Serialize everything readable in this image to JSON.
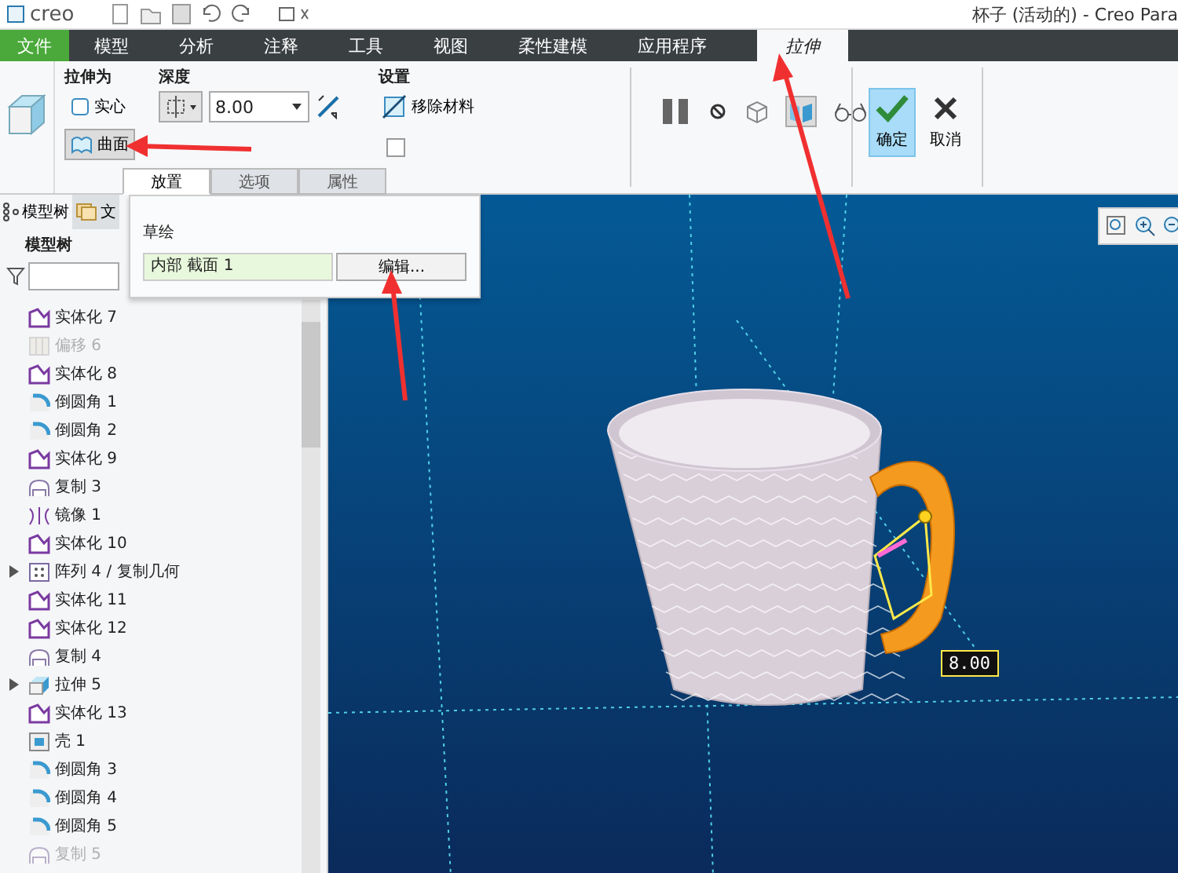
{
  "title_bar": {
    "logo": "creo",
    "title": "杯子 (活动的) - Creo Para"
  },
  "tabs": [
    {
      "label": "文件",
      "kind": "file",
      "selected": false
    },
    {
      "label": "模型",
      "kind": "tab",
      "selected": false
    },
    {
      "label": "分析",
      "kind": "tab",
      "selected": false
    },
    {
      "label": "注释",
      "kind": "tab",
      "selected": false
    },
    {
      "label": "工具",
      "kind": "tab",
      "selected": false
    },
    {
      "label": "视图",
      "kind": "tab",
      "selected": false
    },
    {
      "label": "柔性建模",
      "kind": "tab",
      "selected": false
    },
    {
      "label": "应用程序",
      "kind": "tab",
      "selected": false
    },
    {
      "label": "拉伸",
      "kind": "tab",
      "selected": true
    }
  ],
  "ribbon": {
    "extrude_as": {
      "label": "拉伸为",
      "options": [
        {
          "label": "实心",
          "kind": "solid",
          "selected": false
        },
        {
          "label": "曲面",
          "kind": "surface",
          "selected": true
        }
      ]
    },
    "depth": {
      "label": "深度",
      "value": "8.00"
    },
    "settings": {
      "label": "设置",
      "remove_material": {
        "label": "移除材料",
        "on": false
      },
      "thicken": {
        "checked": false
      }
    },
    "preview_toggles": [
      {
        "kind": "pause",
        "on": false
      },
      {
        "kind": "stop",
        "on": false
      },
      {
        "kind": "preview",
        "on": false
      },
      {
        "kind": "verify",
        "on": true
      },
      {
        "kind": "glasses",
        "on": false
      }
    ],
    "ok": {
      "label": "确定"
    },
    "cancel": {
      "label": "取消"
    },
    "sub_tabs": [
      {
        "label": "放置",
        "selected": true
      },
      {
        "label": "选项",
        "selected": false
      },
      {
        "label": "属性",
        "selected": false
      }
    ]
  },
  "placement_panel": {
    "label": "草绘",
    "section": "内部 截面 1",
    "edit_button": "编辑..."
  },
  "left_panel": {
    "tabs": [
      {
        "label": "模型树",
        "selected": true
      },
      {
        "label": "文",
        "selected": false
      }
    ],
    "heading": "模型树",
    "items": [
      {
        "label": "实体化 7",
        "kind": "solidify",
        "disabled": false,
        "expandable": false
      },
      {
        "label": "偏移 6",
        "kind": "offset",
        "disabled": true,
        "expandable": false
      },
      {
        "label": "实体化 8",
        "kind": "solidify",
        "disabled": false,
        "expandable": false
      },
      {
        "label": "倒圆角 1",
        "kind": "round",
        "disabled": false,
        "expandable": false
      },
      {
        "label": "倒圆角 2",
        "kind": "round",
        "disabled": false,
        "expandable": false
      },
      {
        "label": "实体化 9",
        "kind": "solidify",
        "disabled": false,
        "expandable": false
      },
      {
        "label": "复制 3",
        "kind": "copy",
        "disabled": false,
        "expandable": false
      },
      {
        "label": "镜像 1",
        "kind": "mirror",
        "disabled": false,
        "expandable": false
      },
      {
        "label": "实体化 10",
        "kind": "solidify",
        "disabled": false,
        "expandable": false
      },
      {
        "label": "阵列 4 / 复制几何",
        "kind": "pattern",
        "disabled": false,
        "expandable": true
      },
      {
        "label": "实体化 11",
        "kind": "solidify",
        "disabled": false,
        "expandable": false
      },
      {
        "label": "实体化 12",
        "kind": "solidify",
        "disabled": false,
        "expandable": false
      },
      {
        "label": "复制 4",
        "kind": "copy",
        "disabled": false,
        "expandable": false
      },
      {
        "label": "拉伸 5",
        "kind": "extrude",
        "disabled": false,
        "expandable": true
      },
      {
        "label": "实体化 13",
        "kind": "solidify",
        "disabled": false,
        "expandable": false
      },
      {
        "label": "壳 1",
        "kind": "shell",
        "disabled": false,
        "expandable": false
      },
      {
        "label": "倒圆角 3",
        "kind": "round",
        "disabled": false,
        "expandable": false
      },
      {
        "label": "倒圆角 4",
        "kind": "round",
        "disabled": false,
        "expandable": false
      },
      {
        "label": "倒圆角 5",
        "kind": "round",
        "disabled": false,
        "expandable": false
      },
      {
        "label": "复制 5",
        "kind": "copy",
        "disabled": true,
        "expandable": false
      }
    ]
  },
  "viewport": {
    "dimension": "8.00"
  }
}
